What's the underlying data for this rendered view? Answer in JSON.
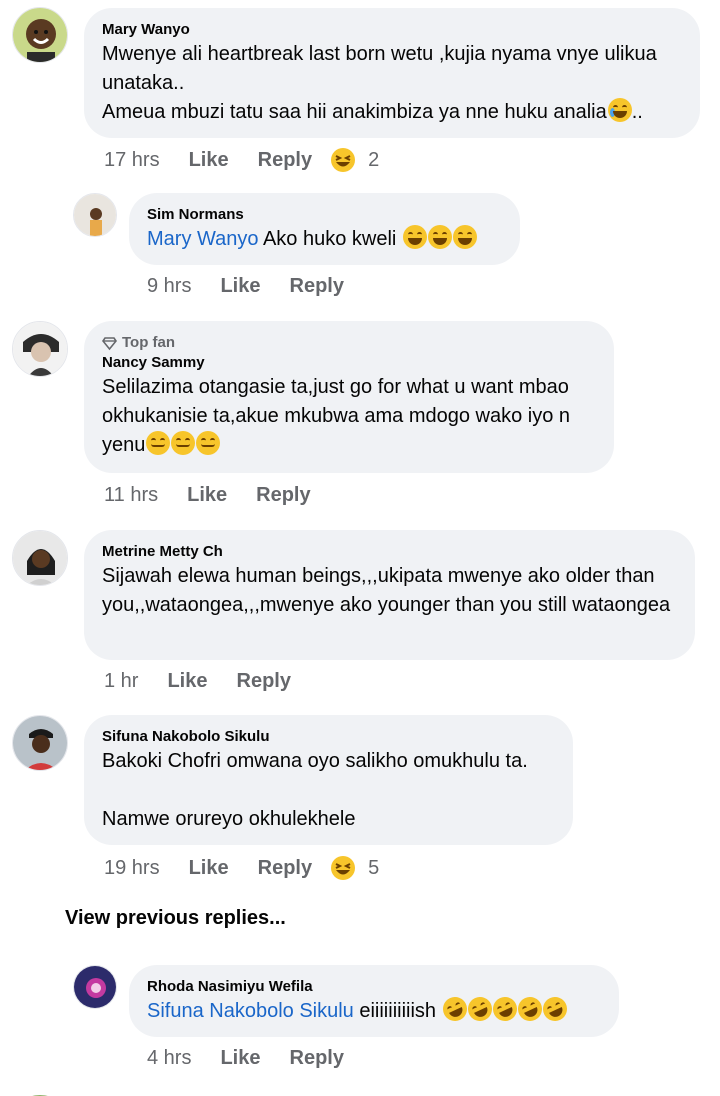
{
  "comments": [
    {
      "author": "Mary Wanyo",
      "text_1": "Mwenye ali heartbreak last born wetu ,kujia nyama vnye ulikua unataka..",
      "text_2": "Ameua mbuzi tatu saa hii anakimbiza ya nne huku analia",
      "text_2_tail": "..",
      "time": "17 hrs",
      "like": "Like",
      "reply": "Reply",
      "reaction_count": "2"
    },
    {
      "author": "Sim Normans",
      "mention": "Mary Wanyo",
      "text": " Ako huko kweli",
      "time": "9 hrs",
      "like": "Like",
      "reply": "Reply"
    },
    {
      "badge": "Top fan",
      "author": "Nancy Sammy",
      "text": "Selilazima otangasie ta,just go for what u want mbao okhukanisie ta,akue mkubwa ama mdogo wako iyo n yenu",
      "time": "11 hrs",
      "like": "Like",
      "reply": "Reply"
    },
    {
      "author": "Metrine Metty Ch",
      "text": "Sijawah elewa human beings,,,ukipata mwenye ako older than you,,wataongea,,,mwenye ako younger than you still wataongea",
      "time": "1 hr",
      "like": "Like",
      "reply": "Reply"
    },
    {
      "author": "Sifuna Nakobolo Sikulu",
      "text_1": "Bakoki Chofri omwana oyo salikho omukhulu ta.",
      "text_2": "Namwe orureyo okhulekhele",
      "time": "19 hrs",
      "like": "Like",
      "reply": "Reply",
      "reaction_count": "5"
    },
    {
      "author": "Rhoda Nasimiyu Wefila",
      "mention": "Sifuna Nakobolo Sikulu",
      "text": " eiiiiiiiiiish",
      "time": "4 hrs",
      "like": "Like",
      "reply": "Reply"
    }
  ],
  "view_previous": "View previous replies...",
  "colors": {
    "bubble": "#f0f2f5",
    "mention": "#1a66c9",
    "meta": "#65676b"
  }
}
